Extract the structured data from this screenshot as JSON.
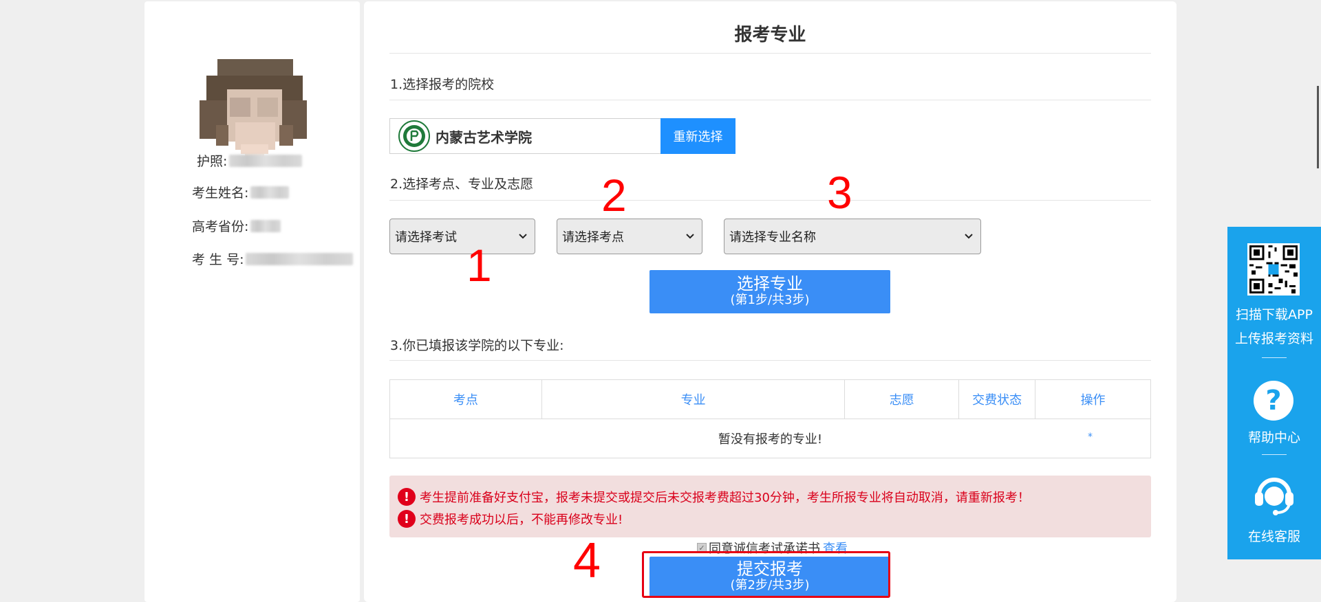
{
  "profile": {
    "passport_label": "护照:",
    "name_label": "考生姓名:",
    "province_label": "高考省份:",
    "exam_no_label": "考 生 号:"
  },
  "main": {
    "title": "报考专业",
    "step1": "1.选择报考的院校",
    "school_name": "内蒙古艺术学院",
    "reselect": "重新选择",
    "step2": "2.选择考点、专业及志愿",
    "select_exam": "请选择考试",
    "select_site": "请选择考点",
    "select_major": "请选择专业名称",
    "choose_major_btn": "选择专业",
    "choose_major_sub": "(第1步/共3步)",
    "step3": "3.你已填报该学院的以下专业:",
    "table_headers": [
      "考点",
      "专业",
      "志愿",
      "交费状态",
      "操作"
    ],
    "empty_text": "暂没有报考的专业!",
    "empty_dot": "*",
    "alerts": [
      "考生提前准备好支付宝，报考未提交或提交后未交报考费超过30分钟，考生所报专业将自动取消，请重新报考！",
      "交费报考成功以后，不能再修改专业!"
    ],
    "agree_text": "同意诚信考试承诺书",
    "view_link": "查看",
    "submit_btn": "提交报考",
    "submit_sub": "(第2步/共3步)"
  },
  "annotations": [
    "1",
    "2",
    "3",
    "4"
  ],
  "sidebar": {
    "scan_download": "扫描下载APP",
    "upload": "上传报考资料",
    "help": "帮助中心",
    "service": "在线客服"
  }
}
